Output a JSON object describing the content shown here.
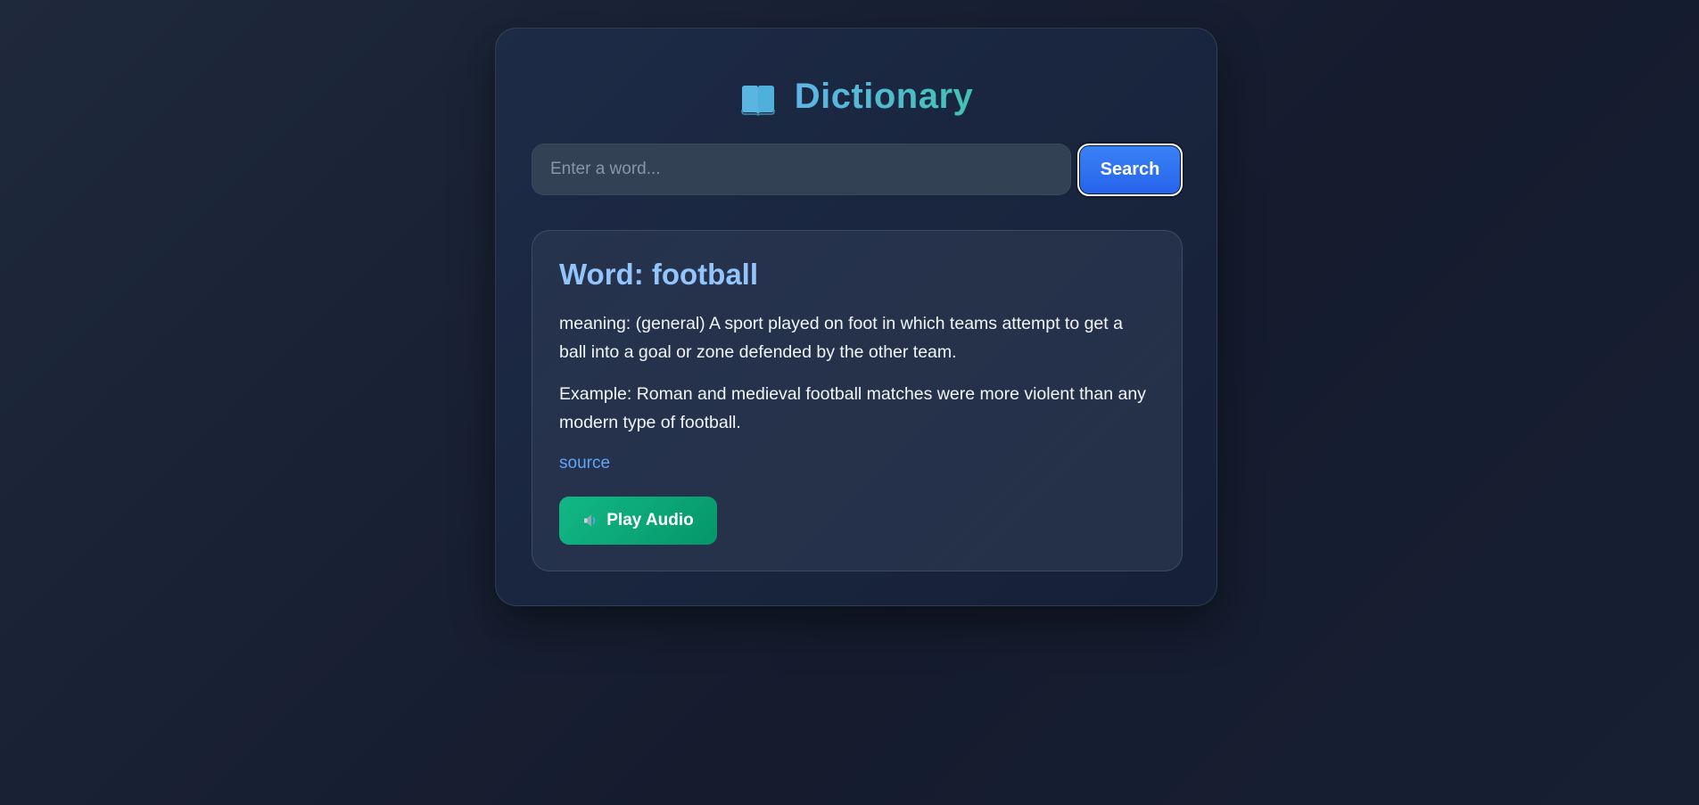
{
  "header": {
    "icon": "book-icon",
    "title": "Dictionary"
  },
  "search": {
    "placeholder": "Enter a word...",
    "value": "",
    "button_label": "Search",
    "icon": "search-icon"
  },
  "result": {
    "heading": "Word: football",
    "meaning": "meaning: (general) A sport played on foot in which teams attempt to get a ball into a goal or zone defended by the other team.",
    "example": "Example: Roman and medieval football matches were more violent than any modern type of football.",
    "source_label": "source",
    "play_audio_label": "Play Audio",
    "play_audio_icon": "speaker-icon"
  },
  "colors": {
    "background": "#1b2438",
    "accent_blue": "#3b82f6",
    "title_gradient_start": "#5fb4e8",
    "title_gradient_end": "#42c2b2",
    "word_heading": "#93c5fd",
    "link": "#60a5fa",
    "play_button": "#10b981"
  }
}
